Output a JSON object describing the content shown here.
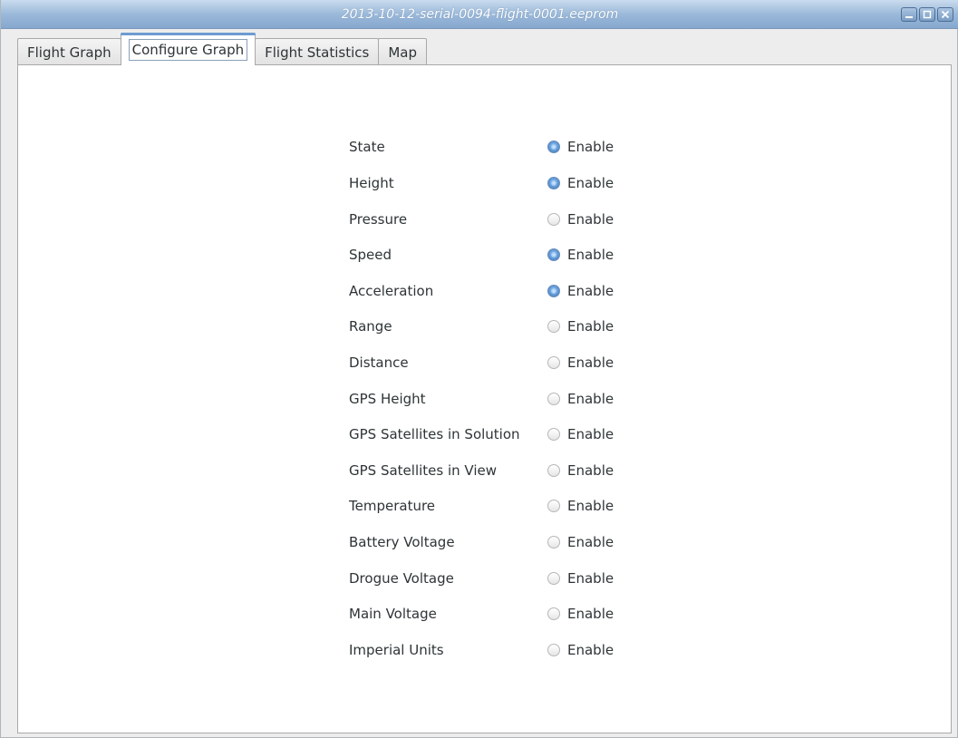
{
  "window": {
    "title": "2013-10-12-serial-0094-flight-0001.eeprom"
  },
  "tabs": [
    {
      "label": "Flight Graph",
      "active": false
    },
    {
      "label": "Configure Graph",
      "active": true
    },
    {
      "label": "Flight Statistics",
      "active": false
    },
    {
      "label": "Map",
      "active": false
    }
  ],
  "enable_label": "Enable",
  "options": [
    {
      "label": "State",
      "enabled": true
    },
    {
      "label": "Height",
      "enabled": true
    },
    {
      "label": "Pressure",
      "enabled": false
    },
    {
      "label": "Speed",
      "enabled": true
    },
    {
      "label": "Acceleration",
      "enabled": true
    },
    {
      "label": "Range",
      "enabled": false
    },
    {
      "label": "Distance",
      "enabled": false
    },
    {
      "label": "GPS Height",
      "enabled": false
    },
    {
      "label": "GPS Satellites in Solution",
      "enabled": false
    },
    {
      "label": "GPS Satellites in View",
      "enabled": false
    },
    {
      "label": "Temperature",
      "enabled": false
    },
    {
      "label": "Battery Voltage",
      "enabled": false
    },
    {
      "label": "Drogue Voltage",
      "enabled": false
    },
    {
      "label": "Main Voltage",
      "enabled": false
    },
    {
      "label": "Imperial Units",
      "enabled": false
    }
  ]
}
